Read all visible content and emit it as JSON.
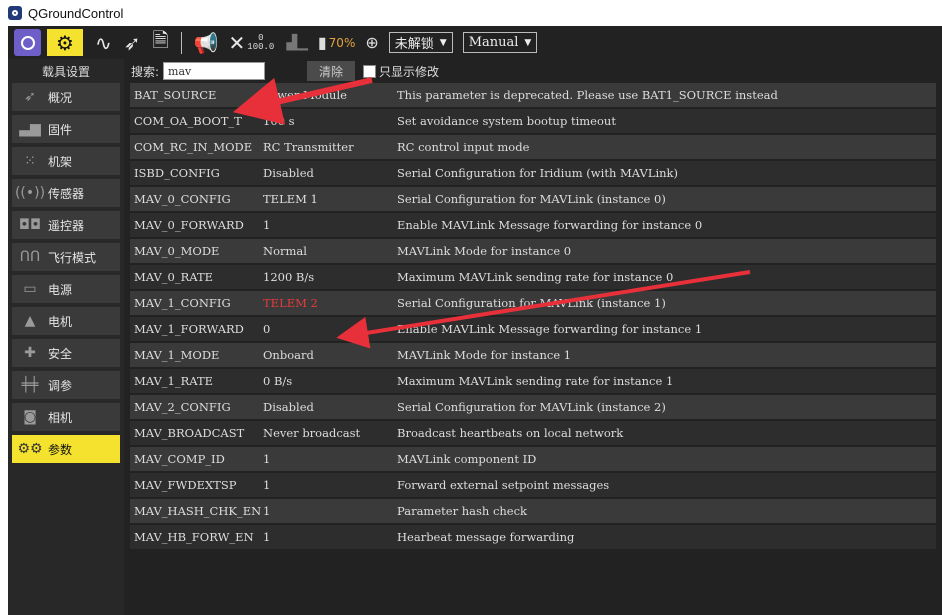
{
  "window": {
    "title": "QGroundControl"
  },
  "toolbar": {
    "count_top": "0",
    "count_bottom": "100.0",
    "battery_pct": "70%",
    "arm_label": "未解锁",
    "mode_label": "Manual",
    "accent": "#f5e22e"
  },
  "sidebar": {
    "header": "载具设置",
    "items": [
      {
        "label": "概况",
        "icon": "paper-plane-icon"
      },
      {
        "label": "固件",
        "icon": "firmware-icon"
      },
      {
        "label": "机架",
        "icon": "airframe-icon"
      },
      {
        "label": "传感器",
        "icon": "sensor-icon"
      },
      {
        "label": "遥控器",
        "icon": "radio-icon"
      },
      {
        "label": "飞行模式",
        "icon": "flight-modes-icon"
      },
      {
        "label": "电源",
        "icon": "power-icon"
      },
      {
        "label": "电机",
        "icon": "motor-icon"
      },
      {
        "label": "安全",
        "icon": "safety-icon"
      },
      {
        "label": "调参",
        "icon": "tuning-icon"
      },
      {
        "label": "相机",
        "icon": "camera-icon"
      },
      {
        "label": "参数",
        "icon": "parameters-icon"
      }
    ]
  },
  "search": {
    "label": "搜索:",
    "value": "mav",
    "clear_label": "清除",
    "show_modified_label": "只显示修改"
  },
  "params": [
    {
      "name": "BAT_SOURCE",
      "value": "Power Module",
      "desc": "This parameter is deprecated. Please use BAT1_SOURCE instead"
    },
    {
      "name": "COM_OA_BOOT_T",
      "value": "100 s",
      "desc": "Set avoidance system bootup timeout"
    },
    {
      "name": "COM_RC_IN_MODE",
      "value": "RC Transmitter",
      "desc": "RC control input mode"
    },
    {
      "name": "ISBD_CONFIG",
      "value": "Disabled",
      "desc": "Serial Configuration for Iridium (with MAVLink)"
    },
    {
      "name": "MAV_0_CONFIG",
      "value": "TELEM 1",
      "desc": "Serial Configuration for MAVLink (instance 0)"
    },
    {
      "name": "MAV_0_FORWARD",
      "value": "1",
      "desc": "Enable MAVLink Message forwarding for instance 0"
    },
    {
      "name": "MAV_0_MODE",
      "value": "Normal",
      "desc": "MAVLink Mode for instance 0"
    },
    {
      "name": "MAV_0_RATE",
      "value": "1200 B/s",
      "desc": "Maximum MAVLink sending rate for instance 0"
    },
    {
      "name": "MAV_1_CONFIG",
      "value": "TELEM 2",
      "desc": "Serial Configuration for MAVLink (instance 1)",
      "modified": true
    },
    {
      "name": "MAV_1_FORWARD",
      "value": "0",
      "desc": "Enable MAVLink Message forwarding for instance 1"
    },
    {
      "name": "MAV_1_MODE",
      "value": "Onboard",
      "desc": "MAVLink Mode for instance 1"
    },
    {
      "name": "MAV_1_RATE",
      "value": "0 B/s",
      "desc": "Maximum MAVLink sending rate for instance 1"
    },
    {
      "name": "MAV_2_CONFIG",
      "value": "Disabled",
      "desc": "Serial Configuration for MAVLink (instance 2)"
    },
    {
      "name": "MAV_BROADCAST",
      "value": "Never broadcast",
      "desc": "Broadcast heartbeats on local network"
    },
    {
      "name": "MAV_COMP_ID",
      "value": "1",
      "desc": "MAVLink component ID"
    },
    {
      "name": "MAV_FWDEXTSP",
      "value": "1",
      "desc": "Forward external setpoint messages"
    },
    {
      "name": "MAV_HASH_CHK_EN",
      "value": "1",
      "desc": "Parameter hash check"
    },
    {
      "name": "MAV_HB_FORW_EN",
      "value": "1",
      "desc": "Hearbeat message forwarding"
    }
  ],
  "annotation": {
    "arrow_color": "#e8303a"
  }
}
